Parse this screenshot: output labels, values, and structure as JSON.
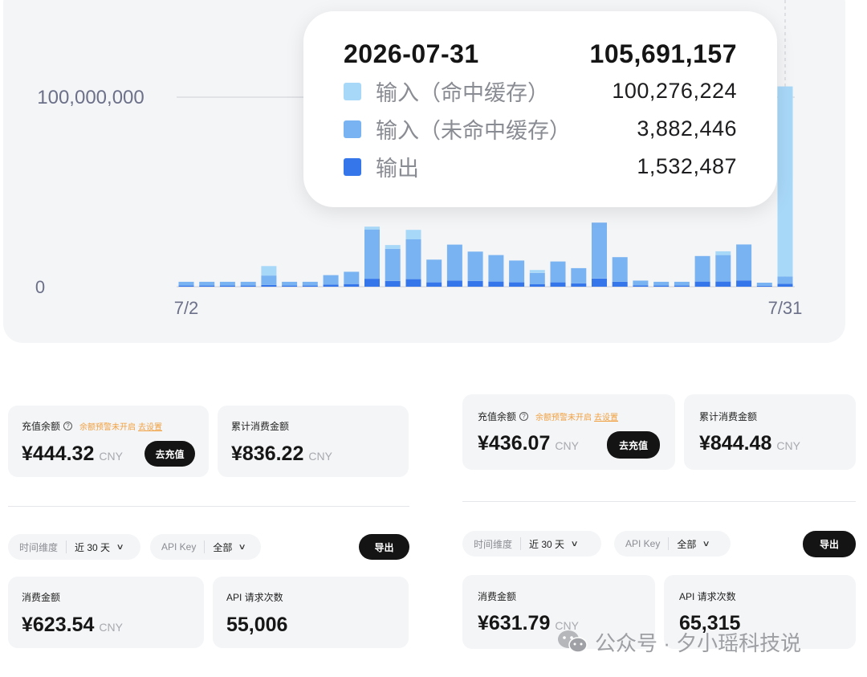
{
  "chart_data": {
    "type": "bar",
    "stacked": true,
    "x": [
      "7/2",
      "7/3",
      "7/4",
      "7/5",
      "7/6",
      "7/7",
      "7/8",
      "7/9",
      "7/10",
      "7/11",
      "7/12",
      "7/13",
      "7/14",
      "7/15",
      "7/16",
      "7/17",
      "7/18",
      "7/19",
      "7/20",
      "7/21",
      "7/22",
      "7/23",
      "7/24",
      "7/25",
      "7/26",
      "7/27",
      "7/28",
      "7/29",
      "7/30",
      "7/31"
    ],
    "x_tick_labels": [
      "7/2",
      "7/31"
    ],
    "y_tick_labels": [
      "0",
      "100,000,000"
    ],
    "ylim": [
      0,
      100000000
    ],
    "series": [
      {
        "name": "输入（命中缓存）",
        "color": "#a8d8f8",
        "values": [
          0,
          0,
          0,
          0,
          5000000,
          0,
          0,
          0,
          0,
          1500000,
          2000000,
          5000000,
          0,
          0,
          0,
          0,
          0,
          1500000,
          0,
          0,
          0,
          0,
          0,
          0,
          0,
          0,
          2000000,
          0,
          0,
          100276224
        ]
      },
      {
        "name": "输入（未命中缓存）",
        "color": "#7ab3f2",
        "values": [
          2000000,
          2000000,
          2000000,
          2000000,
          5000000,
          2000000,
          2000000,
          5000000,
          6500000,
          26000000,
          17000000,
          21000000,
          12000000,
          19000000,
          15500000,
          14000000,
          11500000,
          6000000,
          11000000,
          8000000,
          29500000,
          13000000,
          2500000,
          2000000,
          2000000,
          13500000,
          14000000,
          19000000,
          1600000,
          3882446
        ]
      },
      {
        "name": "输出",
        "color": "#3576eb",
        "values": [
          600000,
          600000,
          600000,
          600000,
          900000,
          600000,
          600000,
          1100000,
          1400000,
          4200000,
          3000000,
          4000000,
          2300000,
          3200000,
          3000000,
          2700000,
          2300000,
          1300000,
          2300000,
          1800000,
          4300000,
          2600000,
          700000,
          600000,
          600000,
          2700000,
          2700000,
          3300000,
          500000,
          1532487
        ]
      }
    ],
    "grid": true,
    "hover_line_at": "7/31"
  },
  "tooltip": {
    "date": "2026-07-31",
    "total": "105,691,157",
    "rows": [
      {
        "label": "输入（命中缓存）",
        "value": "100,276,224",
        "color": "#a8d8f8"
      },
      {
        "label": "输入（未命中缓存）",
        "value": "3,882,446",
        "color": "#7ab3f2"
      },
      {
        "label": "输出",
        "value": "1,532,487",
        "color": "#3576eb"
      }
    ]
  },
  "left": {
    "balance": {
      "title": "充值余额",
      "warn_text": "余额预警未开启",
      "warn_link": "去设置",
      "amount": "¥444.32",
      "unit": "CNY",
      "button": "去充值"
    },
    "total_spend": {
      "title": "累计消费金额",
      "amount": "¥836.22",
      "unit": "CNY"
    },
    "filters": {
      "time_label": "时间维度",
      "time_value": "近 30 天",
      "key_label": "API Key",
      "key_value": "全部",
      "export": "导出"
    },
    "spend": {
      "title": "消费金额",
      "amount": "¥623.54",
      "unit": "CNY"
    },
    "requests": {
      "title": "API 请求次数",
      "amount": "55,006"
    }
  },
  "right": {
    "balance": {
      "title": "充值余额",
      "warn_text": "余额预警未开启",
      "warn_link": "去设置",
      "amount": "¥436.07",
      "unit": "CNY",
      "button": "去充值"
    },
    "total_spend": {
      "title": "累计消费金额",
      "amount": "¥844.48",
      "unit": "CNY"
    },
    "filters": {
      "time_label": "时间维度",
      "time_value": "近 30 天",
      "key_label": "API Key",
      "key_value": "全部",
      "export": "导出"
    },
    "spend": {
      "title": "消费金额",
      "amount": "¥631.79",
      "unit": "CNY"
    },
    "requests": {
      "title": "API 请求次数",
      "amount": "65,315"
    }
  },
  "watermark": {
    "text": "公众号 · 夕小瑶科技说",
    "icon": "wechat-icon"
  },
  "icons": {
    "help": "help-circle-icon",
    "chevron": "chevron-down-icon"
  },
  "colors": {
    "accent_dark": "#141414",
    "warning": "#f0a040",
    "card_bg": "#f4f5f7"
  }
}
